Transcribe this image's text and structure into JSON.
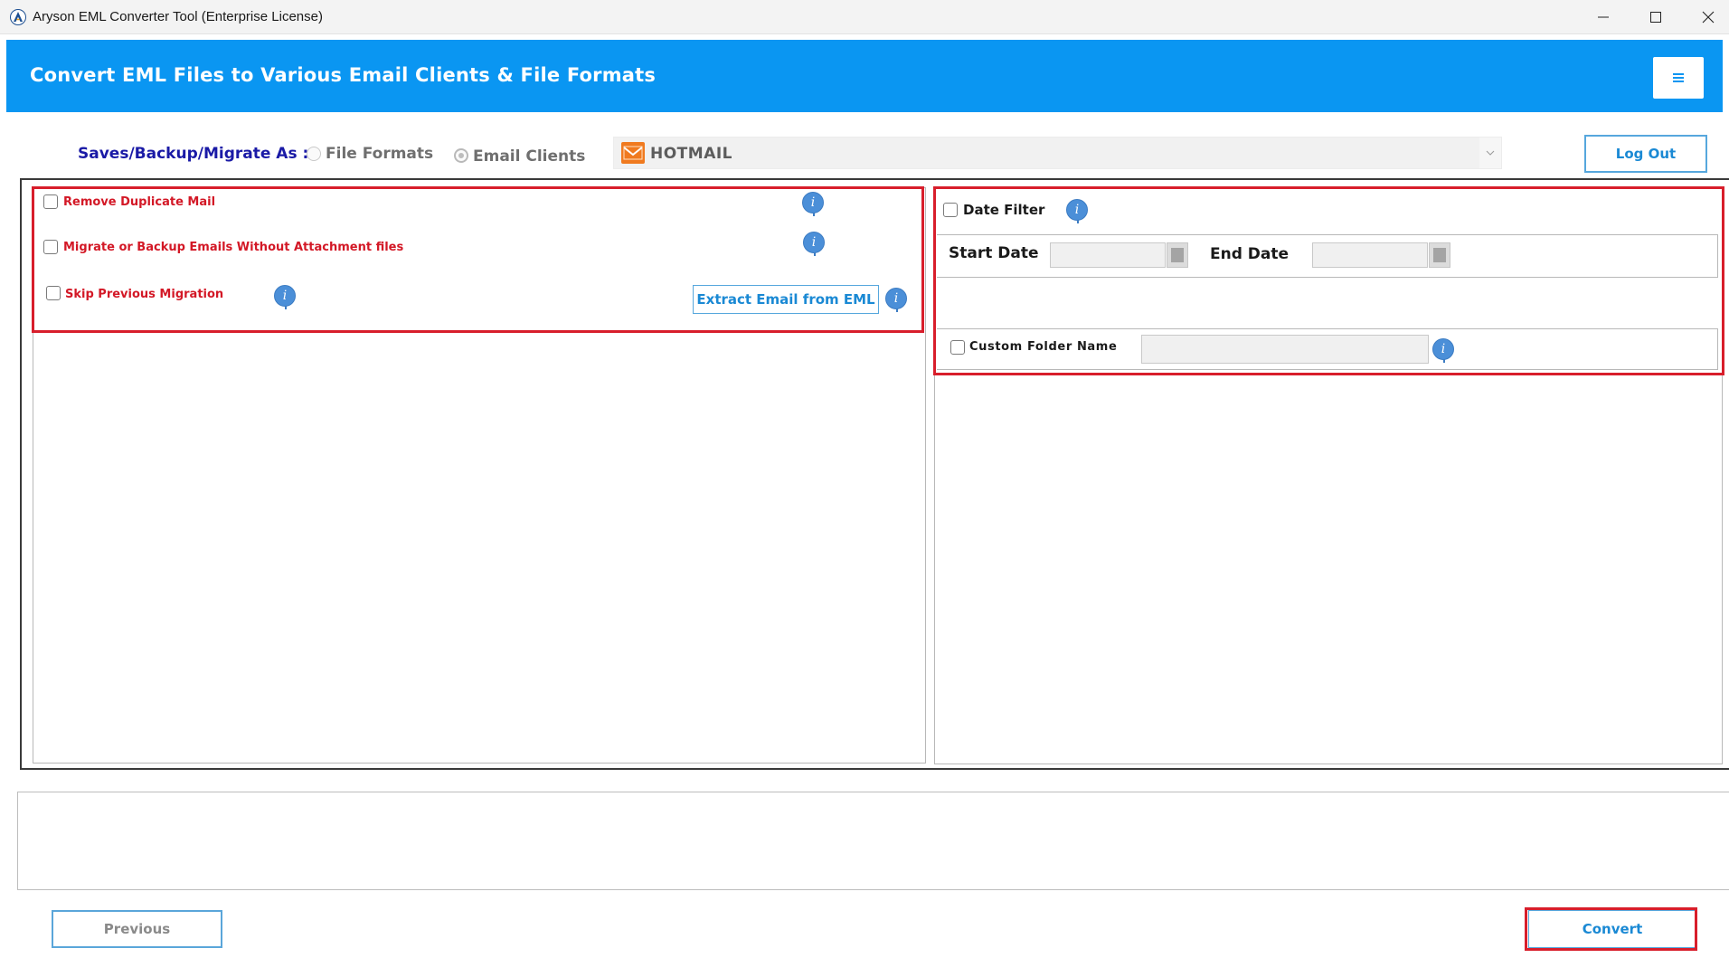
{
  "window": {
    "title": "Aryson EML Converter Tool (Enterprise License)",
    "icon": "aryson-logo-icon"
  },
  "header": {
    "title": "Convert EML Files to Various Email Clients & File Formats",
    "menu_icon": "hamburger-menu-icon",
    "background_color": "#0a96f2"
  },
  "saves": {
    "label": "Saves/Backup/Migrate As :",
    "options": [
      {
        "label": "File Formats",
        "selected": false
      },
      {
        "label": "Email Clients",
        "selected": true
      }
    ],
    "selected_client": "HOTMAIL",
    "selected_client_icon": "envelope-icon"
  },
  "logout_label": "Log Out",
  "options": {
    "remove_duplicate": "Remove Duplicate Mail",
    "without_attachments": "Migrate or Backup Emails Without Attachment files",
    "skip_previous": "Skip Previous Migration",
    "extract_button": "Extract Email from EML"
  },
  "filters": {
    "date_filter_label": "Date Filter",
    "start_date_label": "Start Date",
    "end_date_label": "End Date",
    "start_date_value": "",
    "end_date_value": "",
    "custom_folder_label": "Custom Folder Name",
    "custom_folder_value": ""
  },
  "footer": {
    "previous_label": "Previous",
    "convert_label": "Convert"
  },
  "colors": {
    "highlight_border": "#d81e2b",
    "option_text": "#d31826",
    "accent_blue": "#1a89d4"
  }
}
